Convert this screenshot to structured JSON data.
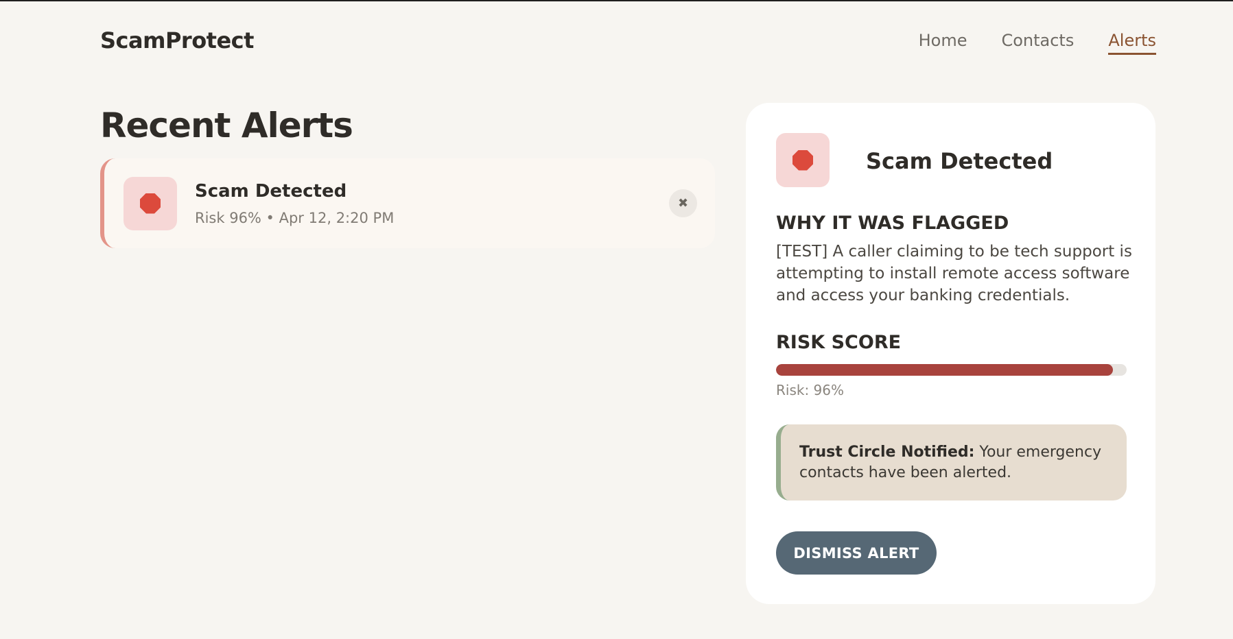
{
  "header": {
    "logo": "ScamProtect",
    "nav": [
      {
        "label": "Home",
        "active": false
      },
      {
        "label": "Contacts",
        "active": false
      },
      {
        "label": "Alerts",
        "active": true
      }
    ]
  },
  "alerts": {
    "title": "Recent Alerts",
    "items": [
      {
        "title": "Scam Detected",
        "meta": "Risk 96% • Apr 12, 2:20 PM",
        "close_glyph": "✖"
      }
    ]
  },
  "detail": {
    "title": "Scam Detected",
    "why_label": "WHY IT WAS FLAGGED",
    "why_text": "[TEST] A caller claiming to be tech support is attempting to install remote access software and access your banking credentials.",
    "risk_label": "RISK SCORE",
    "risk_percent": 96,
    "risk_text": "Risk: 96%",
    "notice_bold": "Trust Circle Notified:",
    "notice_text": " Your emergency contacts have been alerted.",
    "dismiss_label": "DISMISS ALERT"
  },
  "colors": {
    "accent": "#8a5331",
    "danger": "#dc4a3c",
    "risk_bar": "#a8433d",
    "button": "#566875",
    "notice_border": "#97ad8e"
  },
  "icons": {
    "alert_icon": "stop-sign-icon",
    "close_icon": "close-icon"
  }
}
